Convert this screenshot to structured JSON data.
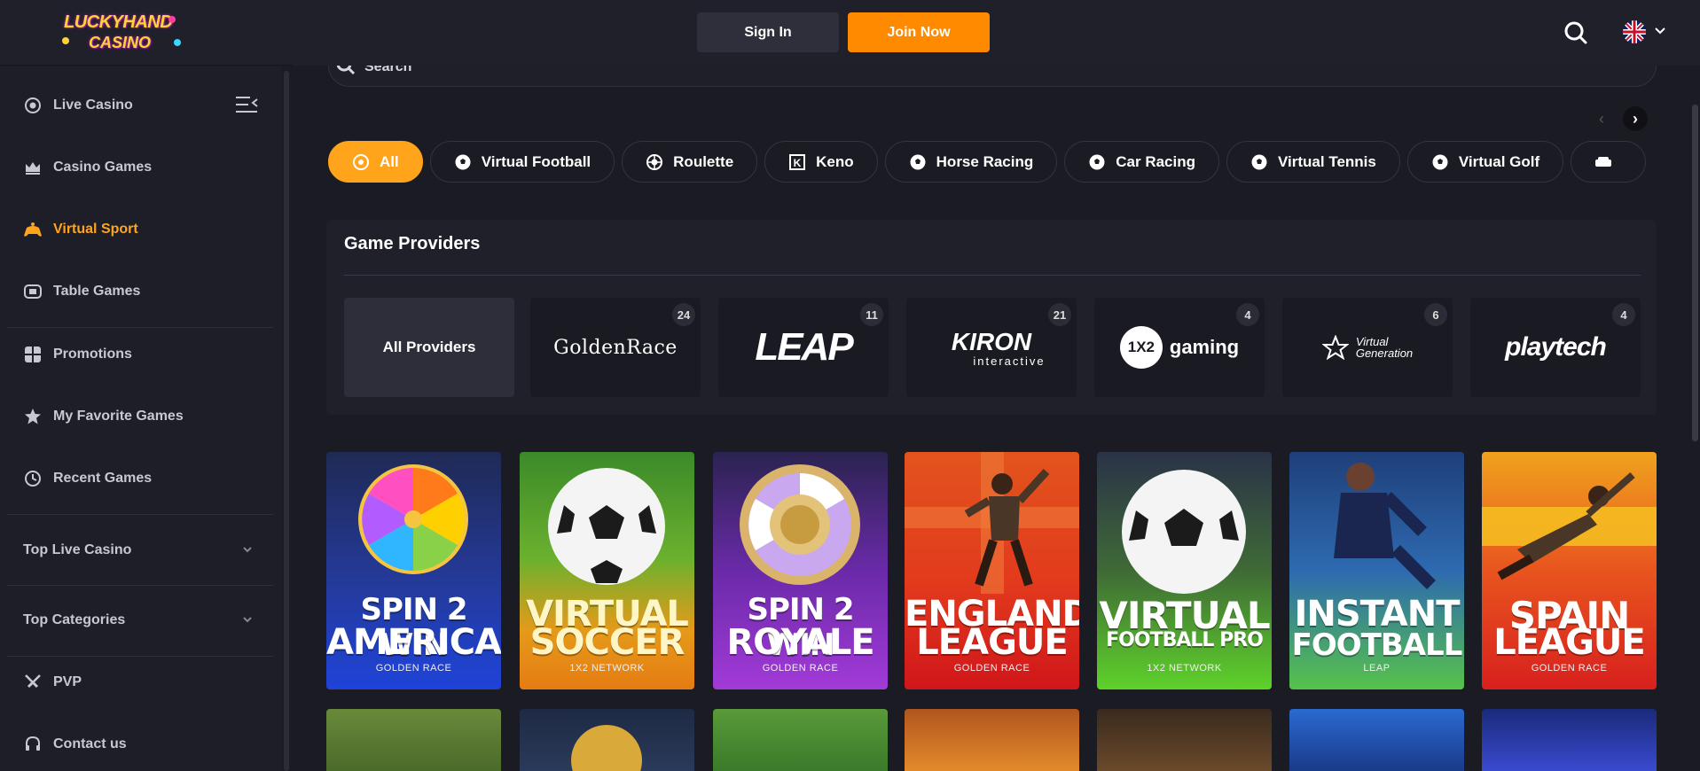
{
  "header": {
    "logo_line1": "LUCKYHAND",
    "logo_line2": "CASINO",
    "signin_label": "Sign In",
    "join_label": "Join Now"
  },
  "sidebar": {
    "items": [
      {
        "label": "Live Casino",
        "icon": "live-casino-icon"
      },
      {
        "label": "Casino Games",
        "icon": "crown-icon"
      },
      {
        "label": "Virtual Sport",
        "icon": "gamepad-icon",
        "active": true
      },
      {
        "label": "Table Games",
        "icon": "table-games-icon"
      },
      {
        "label": "Promotions",
        "icon": "gift-icon"
      },
      {
        "label": "My Favorite Games",
        "icon": "star-icon"
      },
      {
        "label": "Recent Games",
        "icon": "clock-icon"
      },
      {
        "label": "Top Live Casino",
        "icon": ""
      },
      {
        "label": "Top Categories",
        "icon": ""
      },
      {
        "label": "PVP",
        "icon": "swords-icon"
      },
      {
        "label": "Contact us",
        "icon": "headset-icon"
      }
    ]
  },
  "search": {
    "placeholder": "Search"
  },
  "categories": [
    "All",
    "Virtual Football",
    "Roulette",
    "Keno",
    "Horse Racing",
    "Car Racing",
    "Virtual Tennis",
    "Virtual Golf"
  ],
  "providers": {
    "title": "Game Providers",
    "all_label": "All Providers",
    "list": [
      {
        "name": "GoldenRace",
        "count": "24"
      },
      {
        "name": "LEAP",
        "count": "11"
      },
      {
        "name": "KIRON",
        "sub": "interactive",
        "count": "21"
      },
      {
        "name": "gaming",
        "badge": "1X2",
        "count": "4"
      },
      {
        "name": "Virtual",
        "sub": "Generation",
        "count": "6"
      },
      {
        "name": "playtech",
        "count": "4"
      }
    ]
  },
  "games": [
    {
      "t1": "SPIN 2 WIN",
      "t2": "AMERICAN",
      "sub": "GOLDEN RACE"
    },
    {
      "t1": "VIRTUAL",
      "t2": "SOCCER",
      "sub": "1X2 NETWORK"
    },
    {
      "t1": "SPIN 2 WIN",
      "t2": "ROYALE",
      "sub": "GOLDEN RACE"
    },
    {
      "t1": "ENGLAND",
      "t2": "LEAGUE",
      "sub": "GOLDEN RACE"
    },
    {
      "t1": "VIRTUAL",
      "t2": "FOOTBALL PRO",
      "sub": "1X2 NETWORK"
    },
    {
      "t1": "INSTANT",
      "t2": "FOOTBALL",
      "sub": "LEAP"
    },
    {
      "t1": "SPAIN",
      "t2": "LEAGUE",
      "sub": "GOLDEN RACE"
    }
  ],
  "colors": {
    "accent": "#ffa41b",
    "join": "#ff8a00",
    "bg": "#1b1b24"
  }
}
